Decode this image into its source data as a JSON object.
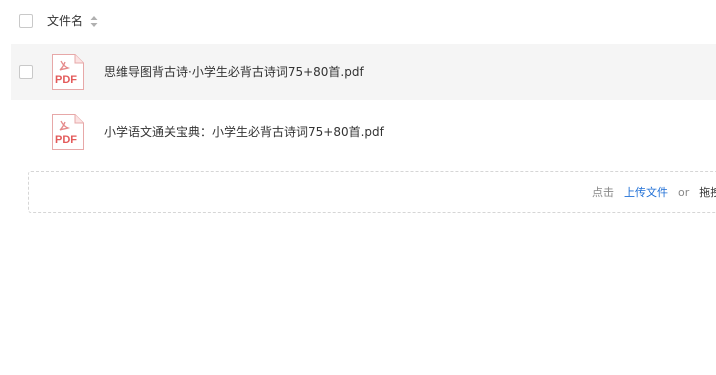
{
  "file_list": {
    "header": {
      "column_label": "文件名"
    },
    "files": [
      {
        "name": "思维导图背古诗·小学生必背古诗词75+80首.pdf",
        "icon_label": "PDF"
      },
      {
        "name": "小学语文通关宝典：小学生必背古诗词75+80首.pdf",
        "icon_label": "PDF"
      }
    ]
  },
  "upload": {
    "prefix": "点击",
    "link": "上传文件",
    "or": "or",
    "drag": "拖拽"
  },
  "colors": {
    "pdf_red": "#e35a5a",
    "link_blue": "#1f6fd6",
    "row_highlight": "#f5f5f5"
  }
}
